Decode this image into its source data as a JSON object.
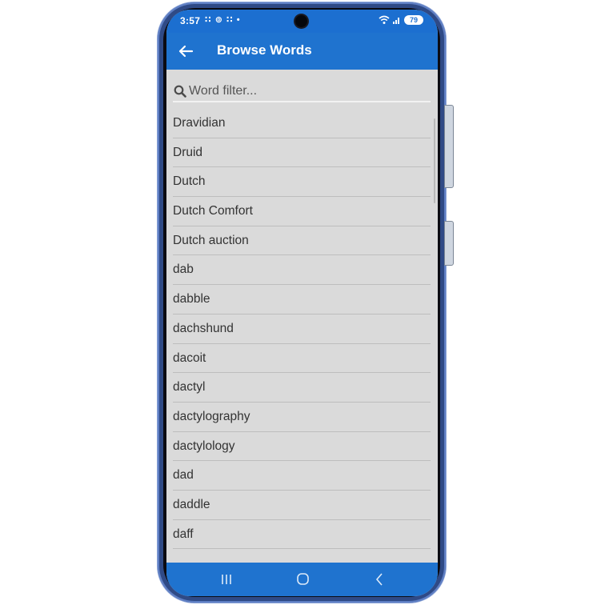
{
  "status_bar": {
    "time": "3:57",
    "left_icons": "∷ ⊚ ∷ •",
    "battery": "79"
  },
  "app_bar": {
    "title": "Browse Words",
    "back_icon": "arrow-left-icon"
  },
  "search": {
    "placeholder": "Word filter...",
    "value": "",
    "icon": "search-icon"
  },
  "words": [
    "Dravidian",
    "Druid",
    "Dutch",
    "Dutch Comfort",
    "Dutch auction",
    "dab",
    "dabble",
    "dachshund",
    "dacoit",
    "dactyl",
    "dactylography",
    "dactylology",
    "dad",
    "daddle",
    "daff"
  ],
  "nav_bar": {
    "recent_icon": "recent-apps-icon",
    "home_icon": "home-icon",
    "back_icon": "back-chevron-icon"
  },
  "colors": {
    "primary": "#1f73cf",
    "list_background": "#dadada",
    "divider": "#bdbdbd"
  }
}
